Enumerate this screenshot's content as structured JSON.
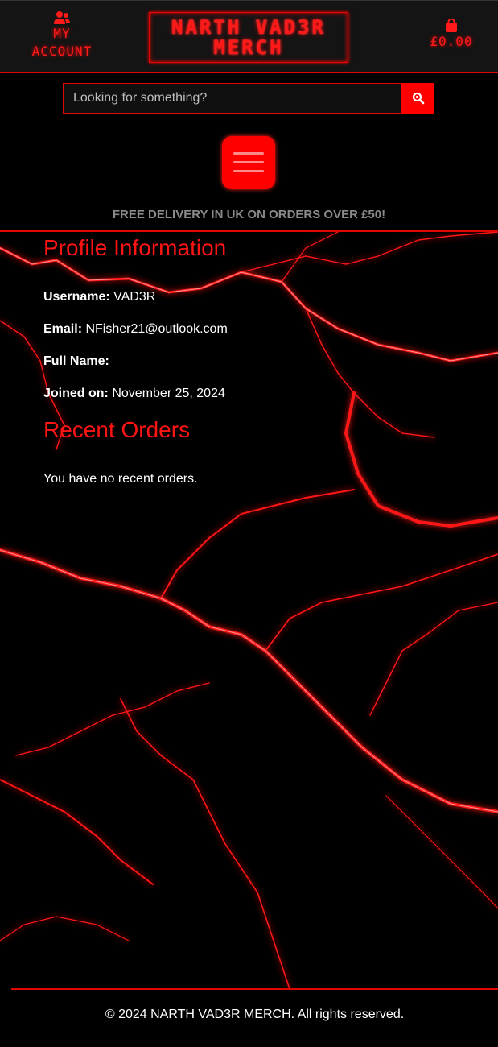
{
  "header": {
    "account_label_1": "MY",
    "account_label_2": "ACCOUNT",
    "logo_line_1": "NARTH VAD3R",
    "logo_line_2": "MERCH",
    "cart_total": "£0.00"
  },
  "search": {
    "placeholder": "Looking for something?"
  },
  "banner": {
    "delivery_text": "FREE DELIVERY IN UK ON ORDERS OVER £50!"
  },
  "profile": {
    "title": "Profile Information",
    "username_label": "Username:",
    "username": "VAD3R",
    "email_label": "Email:",
    "email": "NFisher21@outlook.com",
    "fullname_label": "Full Name:",
    "fullname": "",
    "joined_label": "Joined on:",
    "joined": "November 25, 2024"
  },
  "orders": {
    "title": "Recent Orders",
    "empty_text": "You have no recent orders."
  },
  "footer": {
    "copyright": "© 2024 NARTH VAD3R MERCH. All rights reserved."
  },
  "colors": {
    "accent": "#ff0000",
    "topbar": "#141414"
  },
  "icons": {
    "account": "users-icon",
    "cart": "shopping-bag-icon",
    "search": "magnifier-icon",
    "menu": "hamburger-icon"
  }
}
